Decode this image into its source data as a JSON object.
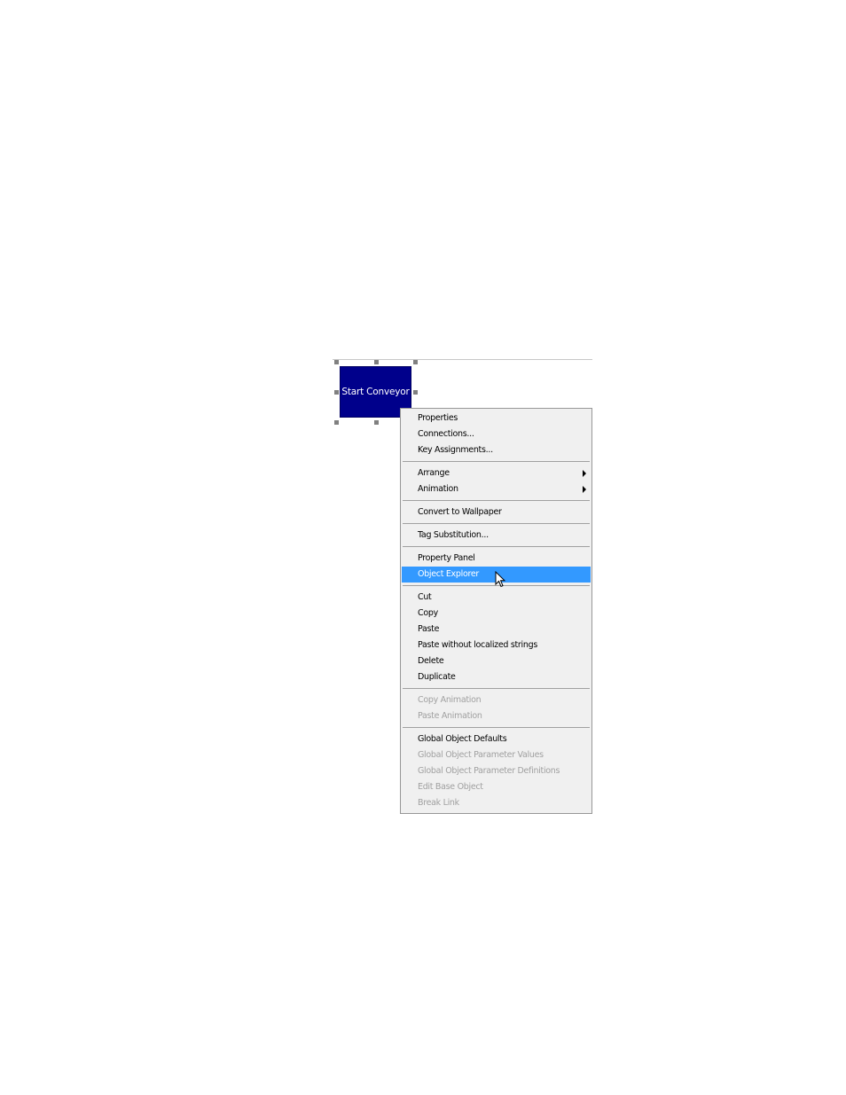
{
  "canvas": {
    "button_label": "Start Conveyor",
    "button_color": "#00008b"
  },
  "menu": {
    "highlight_color": "#3399ff",
    "groups": [
      [
        {
          "label": "Properties",
          "enabled": true
        },
        {
          "label": "Connections...",
          "enabled": true
        },
        {
          "label": "Key Assignments...",
          "enabled": true
        }
      ],
      [
        {
          "label": "Arrange",
          "enabled": true,
          "submenu": true
        },
        {
          "label": "Animation",
          "enabled": true,
          "submenu": true
        }
      ],
      [
        {
          "label": "Convert to Wallpaper",
          "enabled": true
        }
      ],
      [
        {
          "label": "Tag Substitution...",
          "enabled": true
        }
      ],
      [
        {
          "label": "Property Panel",
          "enabled": true
        },
        {
          "label": "Object Explorer",
          "enabled": true,
          "highlighted": true
        }
      ],
      [
        {
          "label": "Cut",
          "enabled": true
        },
        {
          "label": "Copy",
          "enabled": true
        },
        {
          "label": "Paste",
          "enabled": true
        },
        {
          "label": "Paste without localized strings",
          "enabled": true
        },
        {
          "label": "Delete",
          "enabled": true
        },
        {
          "label": "Duplicate",
          "enabled": true
        }
      ],
      [
        {
          "label": "Copy Animation",
          "enabled": false
        },
        {
          "label": "Paste Animation",
          "enabled": false
        }
      ],
      [
        {
          "label": "Global Object Defaults",
          "enabled": true
        },
        {
          "label": "Global Object Parameter Values",
          "enabled": false
        },
        {
          "label": "Global Object Parameter Definitions",
          "enabled": false
        },
        {
          "label": "Edit Base Object",
          "enabled": false
        },
        {
          "label": "Break Link",
          "enabled": false
        }
      ]
    ]
  }
}
